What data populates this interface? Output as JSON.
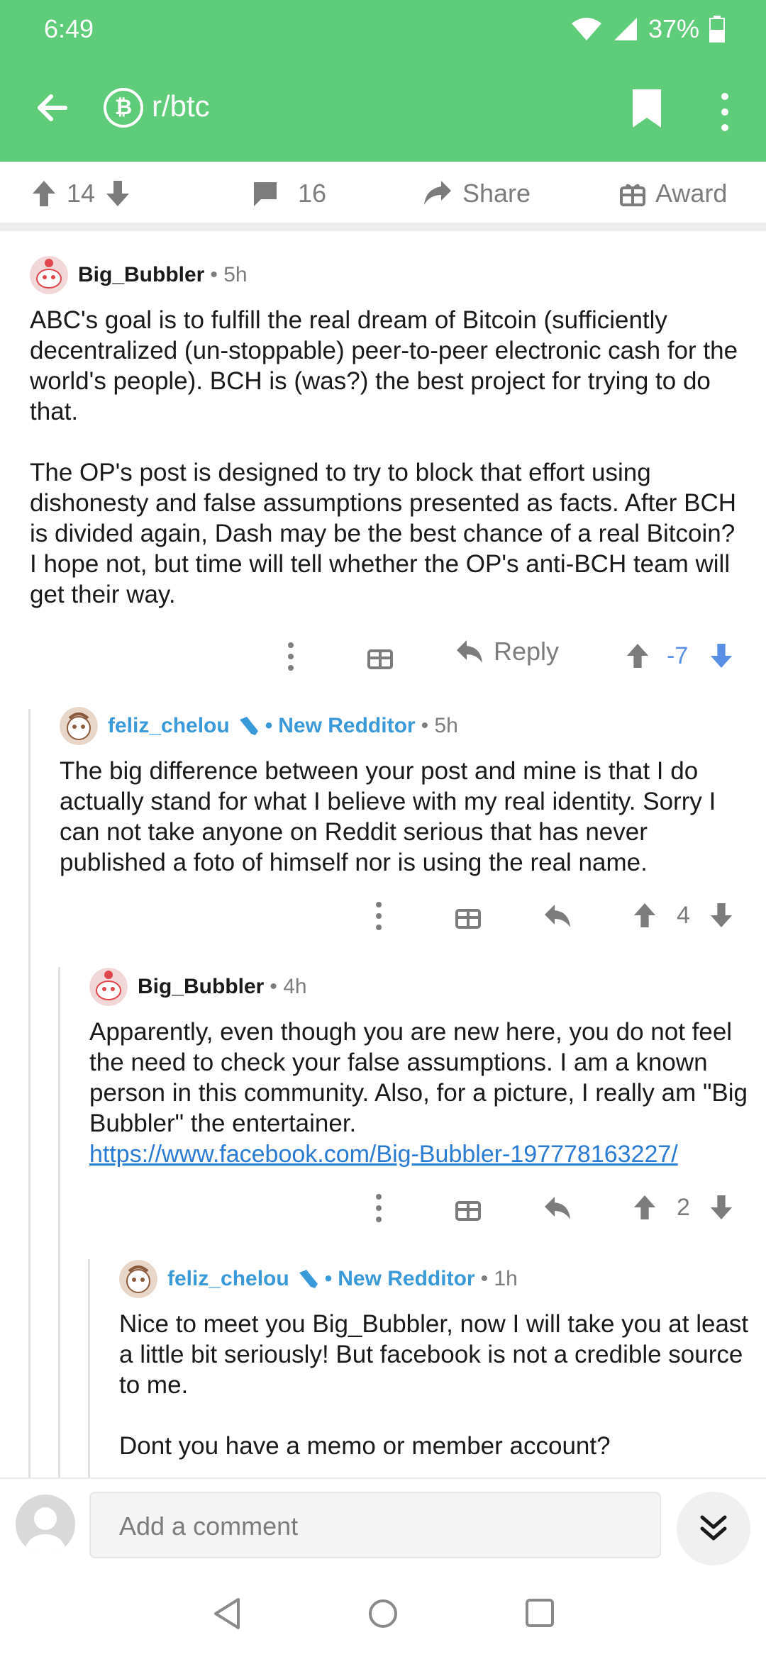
{
  "status": {
    "time": "6:49",
    "battery": "37%"
  },
  "appbar": {
    "subreddit": "r/btc"
  },
  "post_actions": {
    "upvotes": "14",
    "comments": "16",
    "share": "Share",
    "award": "Award"
  },
  "comments": [
    {
      "author": "Big_Bubbler",
      "time": "• 5h",
      "body": "ABC's goal is to fulfill the real dream of Bitcoin (sufficiently decentralized (un-stoppable) peer-to-peer electronic cash for the world's people). BCH is (was?) the best project for trying to do that.\n\nThe OP's post is designed to try to block that effort using dishonesty and false assumptions presented as facts. After BCH is divided again, Dash may be the best chance of a real Bitcoin? I hope not, but time will tell whether the OP's anti-BCH team will get their way.",
      "reply": "Reply",
      "score": "-7"
    },
    {
      "author": "feliz_chelou",
      "flair": "New Redditor",
      "time": "• 5h",
      "body": "The big difference between your post and mine is that I do actually stand for what I believe with my real identity. Sorry I can not take anyone on Reddit serious that has never published a foto of himself nor is using the real name.",
      "score": "4"
    },
    {
      "author": "Big_Bubbler",
      "time": "• 4h",
      "body": "Apparently, even though you are new here, you do not feel the need to check your false assumptions. I am a known person in this community. Also, for a picture, I really am \"Big Bubbler\" the entertainer.",
      "link": "https://www.facebook.com/Big-Bubbler-197778163227/",
      "score": "2"
    },
    {
      "author": "feliz_chelou",
      "flair": "New Redditor",
      "time": "• 1h",
      "body": "Nice to meet you Big_Bubbler, now I will take you at least a little bit seriously! But facebook is not a credible source to me.\n\nDont you have a memo or member account?"
    }
  ],
  "composer": {
    "placeholder": "Add a comment"
  },
  "colors": {
    "green": "#5fcc7a",
    "blue_link": "#3a9ad9",
    "downvote_blue": "#5a8fe6",
    "grey": "#7c7c7c"
  }
}
